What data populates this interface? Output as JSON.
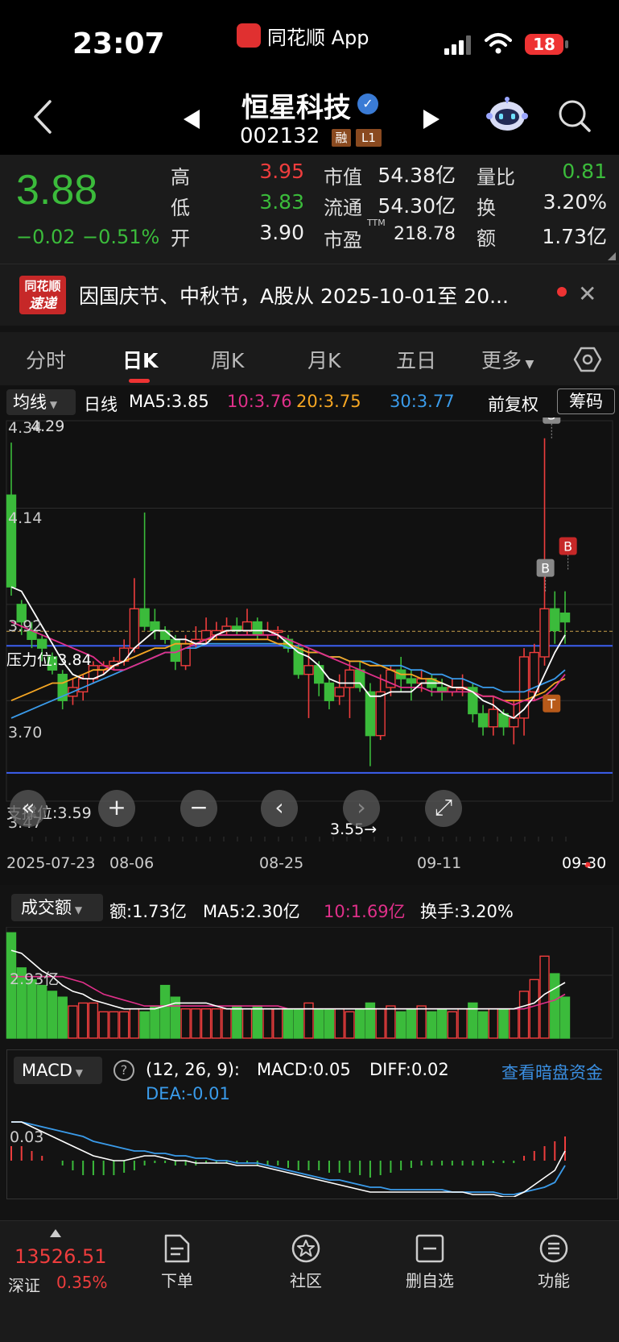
{
  "status_bar": {
    "time": "23:07",
    "app_name": "同花顺 App",
    "battery": "18"
  },
  "header": {
    "stock_name": "恒星科技",
    "stock_code": "002132",
    "tags": [
      "融",
      "L1"
    ]
  },
  "quote": {
    "price": "3.88",
    "change": "−0.02",
    "change_pct": "−0.51%",
    "rows": [
      {
        "l1": "高",
        "v1": "3.95",
        "l2": "市值",
        "v2": "54.38亿",
        "l3": "量比",
        "v3": "0.81"
      },
      {
        "l1": "低",
        "v1": "3.83",
        "l2": "流通",
        "v2": "54.30亿",
        "l3": "换",
        "v3": "3.20%"
      },
      {
        "l1": "开",
        "v1": "3.90",
        "l2": "市盈",
        "l2sup": "TTM",
        "v2": "218.78",
        "l3": "额",
        "v3": "1.73亿"
      }
    ],
    "colors": {
      "up": "#ee3d3d",
      "down": "#3bbb3b"
    }
  },
  "news": {
    "logo_line1": "同花顺",
    "logo_line2": "速递",
    "text": "因国庆节、中秋节，A股从 2025-10-01至 20..."
  },
  "tabs": [
    "分时",
    "日K",
    "周K",
    "月K",
    "五日",
    "更多"
  ],
  "active_tab": "日K",
  "ma_bar": {
    "select": "均线",
    "period": "日线",
    "ma5": "MA5:3.85",
    "ma10": "10:3.76",
    "ma20": "20:3.75",
    "ma30": "30:3.77",
    "adjust": "前复权",
    "chips": "筹码",
    "colors": {
      "ma5": "#ffffff",
      "ma10": "#e0308a",
      "ma20": "#f5a623",
      "ma30": "#3a9bea"
    }
  },
  "kchart": {
    "y_labels": [
      "4.34",
      "4.29",
      "4.14",
      "3.92",
      "3.70",
      "3.47"
    ],
    "pressure_label": "压力位:3.84",
    "support_label": "支撑位:3.59",
    "low_marker": "3.55→",
    "dates": [
      "2025-07-23",
      "08-06",
      "08-25",
      "09-11",
      "09-30"
    ],
    "signals": [
      "S",
      "B",
      "B",
      "T"
    ],
    "controls": [
      "«",
      "+",
      "−",
      "‹",
      "›",
      "⤢"
    ]
  },
  "chart_data": {
    "type": "candlestick",
    "y_range": [
      3.47,
      4.34
    ],
    "pressure": 3.84,
    "support": 3.59,
    "candles": [
      [
        4.17,
        3.96,
        4.29,
        3.94
      ],
      [
        3.92,
        3.88,
        3.93,
        3.85
      ],
      [
        3.86,
        3.84,
        3.88,
        3.82
      ],
      [
        3.84,
        3.82,
        3.85,
        3.79
      ],
      [
        3.8,
        3.77,
        3.81,
        3.76
      ],
      [
        3.76,
        3.7,
        3.77,
        3.68
      ],
      [
        3.71,
        3.73,
        3.75,
        3.69
      ],
      [
        3.72,
        3.75,
        3.76,
        3.7
      ],
      [
        3.75,
        3.78,
        3.79,
        3.74
      ],
      [
        3.77,
        3.78,
        3.79,
        3.76
      ],
      [
        3.78,
        3.79,
        3.8,
        3.77
      ],
      [
        3.79,
        3.82,
        3.84,
        3.78
      ],
      [
        3.82,
        3.91,
        3.98,
        3.81
      ],
      [
        3.91,
        3.87,
        4.13,
        3.86
      ],
      [
        3.88,
        3.86,
        3.91,
        3.84
      ],
      [
        3.86,
        3.84,
        3.87,
        3.83
      ],
      [
        3.84,
        3.79,
        3.85,
        3.77
      ],
      [
        3.78,
        3.83,
        3.85,
        3.77
      ],
      [
        3.83,
        3.84,
        3.87,
        3.82
      ],
      [
        3.84,
        3.86,
        3.89,
        3.83
      ],
      [
        3.85,
        3.86,
        3.88,
        3.84
      ],
      [
        3.86,
        3.87,
        3.89,
        3.85
      ],
      [
        3.87,
        3.86,
        3.89,
        3.85
      ],
      [
        3.86,
        3.88,
        3.91,
        3.85
      ],
      [
        3.88,
        3.85,
        3.89,
        3.84
      ],
      [
        3.85,
        3.86,
        3.88,
        3.84
      ],
      [
        3.86,
        3.86,
        3.87,
        3.84
      ],
      [
        3.84,
        3.82,
        3.85,
        3.81
      ],
      [
        3.82,
        3.76,
        3.83,
        3.75
      ],
      [
        3.76,
        3.78,
        3.82,
        3.66
      ],
      [
        3.78,
        3.74,
        3.79,
        3.71
      ],
      [
        3.74,
        3.7,
        3.75,
        3.68
      ],
      [
        3.71,
        3.73,
        3.76,
        3.69
      ],
      [
        3.73,
        3.77,
        3.79,
        3.66
      ],
      [
        3.77,
        3.73,
        3.79,
        3.72
      ],
      [
        3.72,
        3.62,
        3.74,
        3.55
      ],
      [
        3.62,
        3.72,
        3.76,
        3.61
      ],
      [
        3.73,
        3.77,
        3.78,
        3.71
      ],
      [
        3.77,
        3.75,
        3.8,
        3.72
      ],
      [
        3.75,
        3.74,
        3.77,
        3.7
      ],
      [
        3.74,
        3.75,
        3.77,
        3.72
      ],
      [
        3.75,
        3.73,
        3.76,
        3.71
      ],
      [
        3.73,
        3.72,
        3.75,
        3.7
      ],
      [
        3.72,
        3.73,
        3.75,
        3.71
      ],
      [
        3.73,
        3.73,
        3.76,
        3.71
      ],
      [
        3.73,
        3.67,
        3.74,
        3.65
      ],
      [
        3.67,
        3.64,
        3.69,
        3.62
      ],
      [
        3.64,
        3.68,
        3.71,
        3.62
      ],
      [
        3.67,
        3.64,
        3.68,
        3.62
      ],
      [
        3.64,
        3.66,
        3.7,
        3.6
      ],
      [
        3.66,
        3.8,
        3.82,
        3.62
      ],
      [
        3.72,
        3.81,
        3.83,
        3.7
      ],
      [
        3.8,
        3.91,
        4.3,
        3.78
      ],
      [
        3.91,
        3.86,
        3.95,
        3.83
      ],
      [
        3.9,
        3.88,
        3.95,
        3.83
      ]
    ],
    "ma5": [
      3.96,
      3.95,
      3.91,
      3.87,
      3.83,
      3.79,
      3.76,
      3.75,
      3.75,
      3.76,
      3.78,
      3.79,
      3.82,
      3.84,
      3.86,
      3.86,
      3.84,
      3.84,
      3.83,
      3.83,
      3.85,
      3.86,
      3.86,
      3.86,
      3.86,
      3.86,
      3.85,
      3.83,
      3.81,
      3.8,
      3.78,
      3.75,
      3.74,
      3.74,
      3.74,
      3.71,
      3.71,
      3.72,
      3.72,
      3.72,
      3.74,
      3.74,
      3.74,
      3.73,
      3.73,
      3.72,
      3.7,
      3.69,
      3.67,
      3.66,
      3.68,
      3.71,
      3.76,
      3.81,
      3.85
    ],
    "ma10": [
      3.88,
      3.87,
      3.86,
      3.85,
      3.84,
      3.83,
      3.82,
      3.81,
      3.8,
      3.78,
      3.77,
      3.77,
      3.78,
      3.79,
      3.8,
      3.81,
      3.81,
      3.82,
      3.83,
      3.84,
      3.85,
      3.85,
      3.85,
      3.85,
      3.85,
      3.85,
      3.85,
      3.84,
      3.83,
      3.82,
      3.81,
      3.8,
      3.79,
      3.78,
      3.77,
      3.76,
      3.75,
      3.74,
      3.73,
      3.73,
      3.73,
      3.72,
      3.72,
      3.72,
      3.72,
      3.72,
      3.71,
      3.71,
      3.7,
      3.69,
      3.7,
      3.7,
      3.71,
      3.73,
      3.76
    ],
    "ma20": [
      3.7,
      3.71,
      3.72,
      3.73,
      3.74,
      3.74,
      3.75,
      3.76,
      3.77,
      3.77,
      3.78,
      3.79,
      3.8,
      3.81,
      3.82,
      3.82,
      3.83,
      3.83,
      3.83,
      3.84,
      3.84,
      3.84,
      3.84,
      3.84,
      3.84,
      3.84,
      3.83,
      3.83,
      3.82,
      3.81,
      3.81,
      3.8,
      3.8,
      3.79,
      3.79,
      3.78,
      3.78,
      3.77,
      3.76,
      3.76,
      3.75,
      3.75,
      3.74,
      3.73,
      3.73,
      3.72,
      3.71,
      3.71,
      3.7,
      3.7,
      3.7,
      3.71,
      3.72,
      3.74,
      3.75
    ],
    "ma30": [
      3.66,
      3.67,
      3.68,
      3.69,
      3.7,
      3.71,
      3.72,
      3.73,
      3.74,
      3.75,
      3.76,
      3.77,
      3.78,
      3.79,
      3.8,
      3.81,
      3.81,
      3.82,
      3.82,
      3.83,
      3.83,
      3.83,
      3.83,
      3.83,
      3.83,
      3.83,
      3.83,
      3.82,
      3.82,
      3.81,
      3.81,
      3.8,
      3.8,
      3.79,
      3.79,
      3.79,
      3.78,
      3.78,
      3.78,
      3.77,
      3.77,
      3.76,
      3.76,
      3.75,
      3.75,
      3.74,
      3.73,
      3.73,
      3.72,
      3.72,
      3.72,
      3.73,
      3.74,
      3.75,
      3.77
    ],
    "volume": {
      "label_value": "2.93亿",
      "amount": "额:1.73亿",
      "ma5": "MA5:2.30亿",
      "ma10": "10:1.69亿",
      "turnover": "换手:3.20%",
      "bars": [
        3.6,
        2.4,
        2.0,
        1.8,
        1.6,
        1.4,
        1.1,
        1.2,
        1.2,
        0.9,
        0.9,
        0.9,
        1.0,
        0.9,
        1.1,
        1.8,
        1.4,
        1.0,
        1.0,
        1.0,
        1.0,
        1.0,
        1.1,
        1.0,
        1.1,
        1.0,
        1.0,
        1.0,
        1.0,
        1.2,
        1.0,
        1.0,
        1.0,
        0.9,
        1.0,
        1.2,
        1.0,
        1.1,
        0.9,
        1.0,
        1.1,
        0.9,
        1.0,
        0.9,
        1.0,
        1.2,
        0.9,
        1.0,
        1.0,
        1.0,
        1.6,
        2.0,
        2.8,
        2.2,
        1.4
      ],
      "ma5_line": [
        3.0,
        2.9,
        2.6,
        2.3,
        2.1,
        1.8,
        1.6,
        1.5,
        1.3,
        1.2,
        1.1,
        1.0,
        1.0,
        1.0,
        1.0,
        1.1,
        1.2,
        1.2,
        1.2,
        1.2,
        1.1,
        1.0,
        1.0,
        1.0,
        1.0,
        1.0,
        1.0,
        1.0,
        1.0,
        1.0,
        1.0,
        1.0,
        1.0,
        1.0,
        1.0,
        1.0,
        1.0,
        1.0,
        1.0,
        1.0,
        1.0,
        1.0,
        1.0,
        1.0,
        1.0,
        1.0,
        1.0,
        1.0,
        1.0,
        1.0,
        1.1,
        1.2,
        1.5,
        1.7,
        1.9
      ],
      "ma10_line": [
        2.1,
        2.1,
        2.1,
        2.1,
        2.1,
        2.1,
        2.0,
        1.9,
        1.7,
        1.5,
        1.4,
        1.3,
        1.2,
        1.1,
        1.1,
        1.1,
        1.1,
        1.1,
        1.1,
        1.1,
        1.1,
        1.1,
        1.1,
        1.1,
        1.1,
        1.1,
        1.1,
        1.0,
        1.0,
        1.0,
        1.0,
        1.0,
        1.0,
        1.0,
        1.0,
        1.0,
        1.0,
        1.0,
        1.0,
        1.0,
        1.0,
        1.0,
        1.0,
        1.0,
        1.0,
        1.0,
        1.0,
        1.0,
        1.0,
        1.0,
        1.0,
        1.1,
        1.2,
        1.3,
        1.5
      ]
    },
    "macd": {
      "params": "(12, 26, 9):",
      "macd_txt": "MACD:0.05",
      "diff_txt": "DIFF:0.02",
      "dea_txt": "DEA:-0.01",
      "link": "查看暗盘资金",
      "y_label": "0.03",
      "hist": [
        0.03,
        0.03,
        0.02,
        0.01,
        0.0,
        -0.01,
        -0.02,
        -0.03,
        -0.03,
        -0.03,
        -0.03,
        -0.025,
        -0.02,
        -0.01,
        -0.005,
        -0.005,
        -0.01,
        -0.01,
        -0.01,
        -0.005,
        -0.005,
        -0.005,
        -0.005,
        -0.005,
        -0.01,
        -0.01,
        -0.01,
        -0.015,
        -0.02,
        -0.02,
        -0.02,
        -0.025,
        -0.025,
        -0.025,
        -0.03,
        -0.035,
        -0.03,
        -0.025,
        -0.02,
        -0.015,
        -0.01,
        -0.01,
        -0.01,
        -0.01,
        -0.01,
        -0.01,
        -0.01,
        -0.005,
        -0.005,
        -0.005,
        0.01,
        0.02,
        0.03,
        0.04,
        0.05
      ],
      "diff": [
        0.08,
        0.08,
        0.07,
        0.06,
        0.05,
        0.04,
        0.03,
        0.02,
        0.01,
        0.005,
        0.0,
        0.0,
        0.005,
        0.01,
        0.01,
        0.005,
        0.0,
        0.0,
        -0.005,
        -0.005,
        -0.005,
        -0.005,
        -0.01,
        -0.01,
        -0.01,
        -0.015,
        -0.02,
        -0.025,
        -0.03,
        -0.035,
        -0.04,
        -0.045,
        -0.05,
        -0.055,
        -0.06,
        -0.065,
        -0.065,
        -0.065,
        -0.065,
        -0.065,
        -0.065,
        -0.065,
        -0.065,
        -0.065,
        -0.065,
        -0.07,
        -0.07,
        -0.07,
        -0.075,
        -0.075,
        -0.065,
        -0.05,
        -0.035,
        -0.02,
        0.02
      ],
      "dea": [
        0.08,
        0.08,
        0.075,
        0.07,
        0.065,
        0.06,
        0.055,
        0.05,
        0.04,
        0.035,
        0.03,
        0.025,
        0.02,
        0.02,
        0.015,
        0.015,
        0.01,
        0.01,
        0.005,
        0.005,
        0.0,
        0.0,
        -0.005,
        -0.005,
        -0.005,
        -0.01,
        -0.015,
        -0.02,
        -0.025,
        -0.03,
        -0.035,
        -0.04,
        -0.04,
        -0.045,
        -0.05,
        -0.055,
        -0.055,
        -0.06,
        -0.06,
        -0.06,
        -0.06,
        -0.06,
        -0.06,
        -0.065,
        -0.065,
        -0.065,
        -0.065,
        -0.065,
        -0.07,
        -0.07,
        -0.065,
        -0.06,
        -0.055,
        -0.045,
        -0.01
      ]
    }
  },
  "bottom_nav": {
    "index_value": "13526.51",
    "index_name": "深证",
    "index_pct": "0.35%",
    "items": [
      {
        "label": "下单",
        "icon": "order-icon"
      },
      {
        "label": "社区",
        "icon": "community-icon"
      },
      {
        "label": "删自选",
        "icon": "remove-watchlist-icon"
      },
      {
        "label": "功能",
        "icon": "menu-icon"
      }
    ]
  }
}
